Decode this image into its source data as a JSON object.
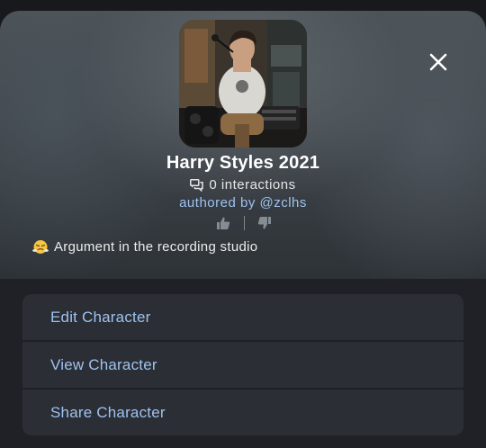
{
  "character": {
    "name": "Harry Styles 2021",
    "interactions": "0 interactions",
    "author": "authored by @zclhs",
    "greeting": "Argument in the recording studio"
  },
  "icons": {
    "close": "close-icon",
    "interactions": "chat-bubbles-icon",
    "upvote": "thumbs-up-icon",
    "downvote": "thumbs-down-icon",
    "greeting_emoji": "face-with-steam-emoji"
  },
  "actions": [
    {
      "label": "Edit Character"
    },
    {
      "label": "View Character"
    },
    {
      "label": "Share Character"
    }
  ],
  "colors": {
    "accent": "#9ec2f0",
    "sheet": "#1f2126",
    "action_bg": "#2b2e34"
  }
}
